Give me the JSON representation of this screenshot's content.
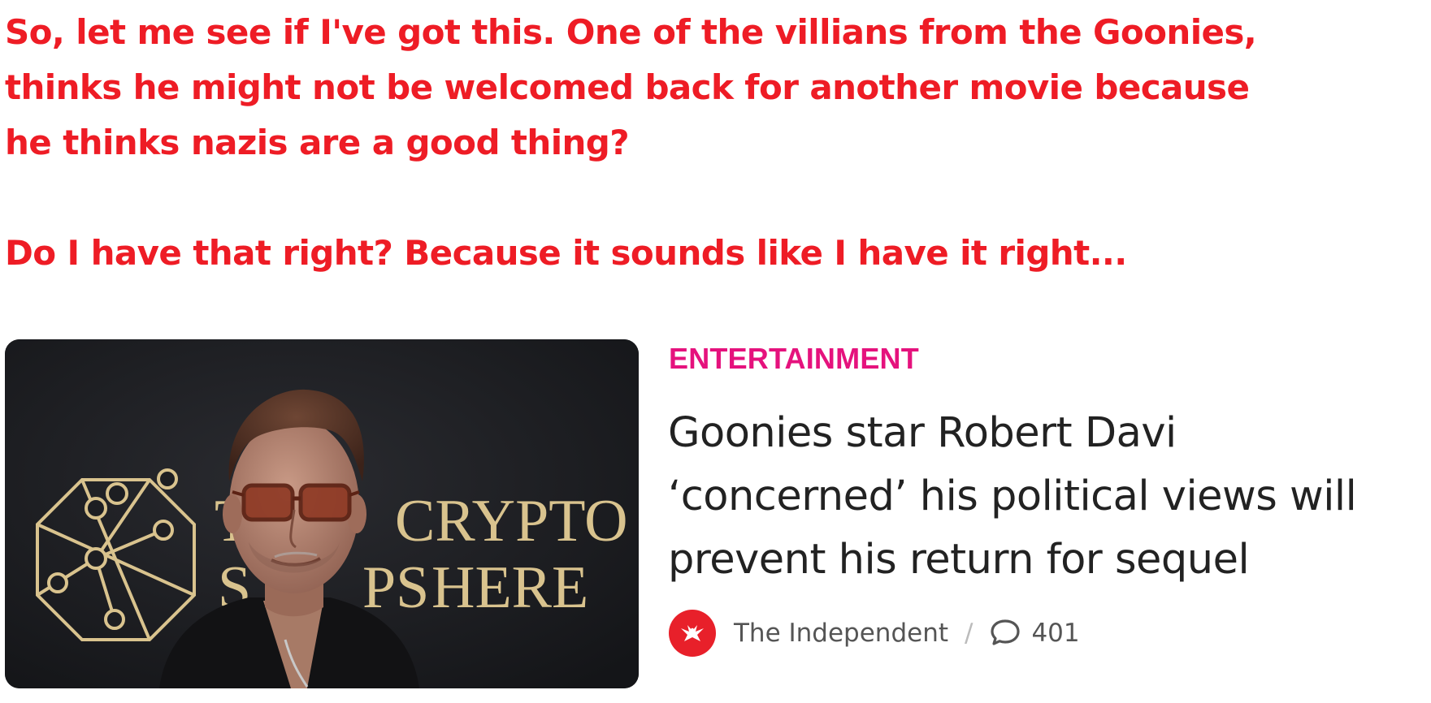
{
  "comment": {
    "line1": "So, let me see if I've got this. One of the villians from the Goonies,",
    "line2": "thinks he might not be welcomed back for another movie because",
    "line3": "he thinks nazis are a good thing?",
    "line4": "Do I have that right? Because it sounds like I have it right..."
  },
  "article": {
    "category": "ENTERTAINMENT",
    "headline": "Goonies star Robert Davi ‘concerned’ his political views will prevent his return for sequel",
    "source": "The Independent",
    "separator": "/",
    "comment_count": "401",
    "image": {
      "backdrop_text_line1": "CRYPTO",
      "backdrop_text_line2": "HERE",
      "backdrop_text_fragment1": "T",
      "backdrop_text_fragment2": "S",
      "backdrop_text_fragment3": "PS"
    }
  },
  "colors": {
    "comment_text": "#ee1c25",
    "category": "#e5127d",
    "headline": "#222222",
    "logo_bg": "#e8202a",
    "backdrop": "#1d1e22",
    "backdrop_text": "#d9c38e"
  },
  "icons": {
    "source_logo": "eagle-logo-icon",
    "comments": "speech-bubble-icon"
  }
}
